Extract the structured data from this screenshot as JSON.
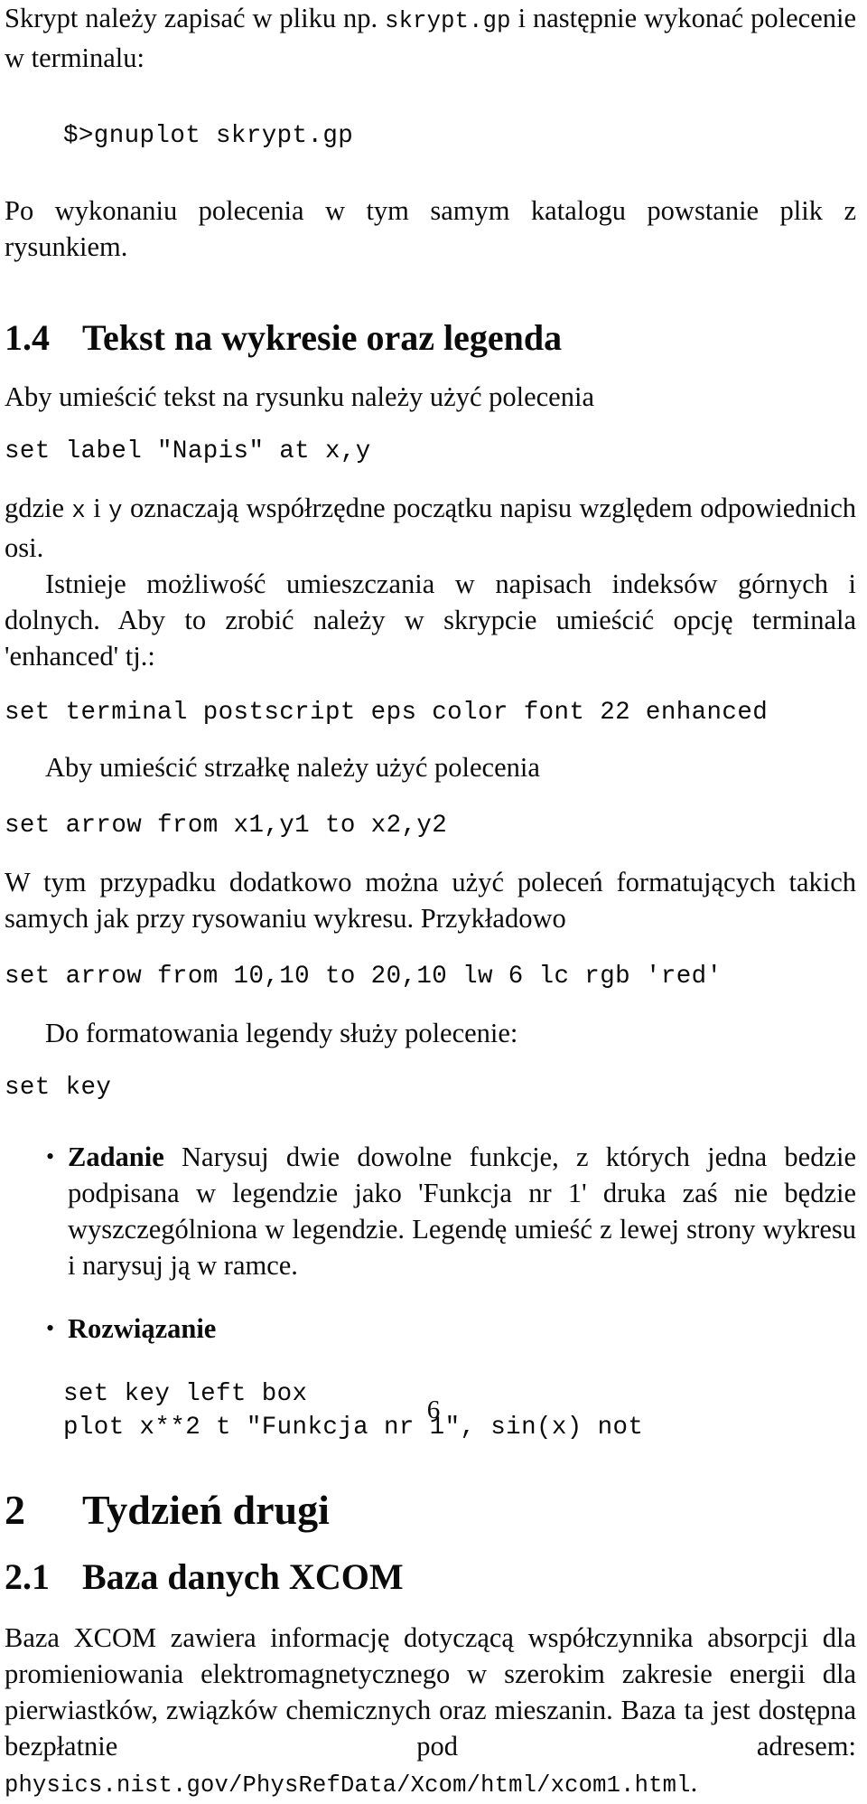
{
  "document": {
    "language": "pl",
    "page_number": "6"
  },
  "intro": {
    "para_1_a": "Skrypt należy zapisać w pliku np. ",
    "para_1_code": "skrypt.gp",
    "para_1_b": " i następnie wykonać polecenie w terminalu:",
    "code_run": "$>gnuplot skrypt.gp",
    "para_2": "Po wykonaniu polecenia w tym samym katalogu powstanie plik z rysunkiem."
  },
  "section_1_4": {
    "number": "1.4",
    "title": "Tekst na wykresie oraz legenda",
    "para_intro": "Aby umieścić tekst na rysunku należy użyć polecenia",
    "code_label": "set label \"Napis\" at x,y",
    "para_gdzie_a": "gdzie ",
    "para_gdzie_x": "x",
    "para_gdzie_mid": " i ",
    "para_gdzie_y": "y",
    "para_gdzie_b": " oznaczają współrzędne początku napisu względem odpowiednich osi.",
    "para_indeksy": "Istnieje możliwość umieszczania w napisach indeksów górnych i dolnych. Aby to zrobić należy w skrypcie umieścić opcję terminala 'enhanced' tj.:",
    "code_terminal": "set terminal postscript eps color font 22 enhanced",
    "para_strzalka": "Aby umieścić strzałkę należy użyć polecenia",
    "code_arrow": "set arrow from x1,y1 to x2,y2",
    "para_formatowanie": "W tym przypadku dodatkowo można użyć poleceń formatujących takich samych jak przy rysowaniu wykresu. Przykładowo",
    "code_arrow_red": "set arrow from 10,10 to 20,10 lw 6 lc rgb 'red'",
    "para_legenda": "Do formatowania legendy służy polecenie:",
    "code_key": "set key",
    "bullets": [
      {
        "marker": "•",
        "lead": "Zadanie",
        "text": " Narysuj dwie dowolne funkcje, z których jedna bedzie podpisana w legendzie jako 'Funkcja nr 1' druka zaś nie będzie wyszczególniona w legendzie. Legendę umieść z lewej strony wykresu i narysuj ją w ramce."
      },
      {
        "marker": "•",
        "lead": "Rozwiązanie",
        "text": ""
      }
    ],
    "solution_code_line_1": "set key left box",
    "solution_code_line_2": "plot x**2 t \"Funkcja nr 1\", sin(x) not"
  },
  "section_2": {
    "number": "2",
    "title": "Tydzień drugi"
  },
  "section_2_1": {
    "number": "2.1",
    "title": "Baza danych XCOM",
    "para_a": "Baza XCOM zawiera informację dotyczącą współczynnika absorpcji dla promieniowania elektromagnetycznego w szerokim zakresie energii dla pierwiastków, związków chemicznych oraz mieszanin. Baza ta jest dostępna bezpłatnie pod adresem: ",
    "url": "physics.nist.gov/PhysRefData/Xcom/html/xcom1.html",
    "para_b": "."
  }
}
